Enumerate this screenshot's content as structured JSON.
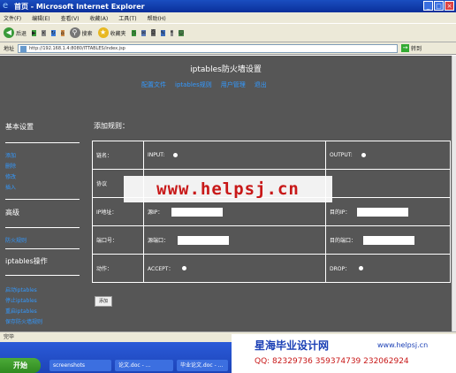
{
  "window": {
    "title": "首页 - Microsoft Internet Explorer",
    "min": "_",
    "max": "□",
    "close": "×"
  },
  "menu": [
    "文件(F)",
    "编辑(E)",
    "查看(V)",
    "收藏(A)",
    "工具(T)",
    "帮助(H)"
  ],
  "toolbar": {
    "back": "后退",
    "search": "搜索",
    "favorites": "收藏夹"
  },
  "address": {
    "url": "http://192.168.1.4:8080/ITTABLES/index.jsp",
    "go": "转到"
  },
  "page": {
    "title": "iptables防火墙设置",
    "nav": [
      "配置文件",
      "iptables规则",
      "用户管理",
      "退出"
    ],
    "sidebar": {
      "basic_heading": "基本设置",
      "basic_links": [
        "添加",
        "删除",
        "修改",
        "插入"
      ],
      "advanced_heading": "高级",
      "advanced_links": [
        "防火规则"
      ],
      "ops_heading": "iptables操作",
      "ops_links": [
        "启动iptables",
        "停止iptables",
        "重启iptables",
        "保存防火墙规则"
      ]
    },
    "form_title": "添加规则：",
    "rows": {
      "chain_label": "链名：",
      "input_label": "INPUT:",
      "output_label": "OUTPUT:",
      "protocol_label": "协议",
      "ip_label": "IP地址：",
      "src_ip_label": "源IP：",
      "dst_ip_label": "目的IP：",
      "port_label": "端口号：",
      "src_port_label": "源端口：",
      "dst_port_label": "目的端口：",
      "action_label": "动作：",
      "accept_label": "ACCEPT：",
      "drop_label": "DROP："
    },
    "add_button": "添加"
  },
  "watermark": "www.helpsj.cn",
  "status": "完毕",
  "taskbar": {
    "start": "开始",
    "tasks": [
      "screenshots",
      "论文.doc - ...",
      "毕业论文.doc - ..."
    ]
  },
  "banner": {
    "title": "星海毕业设计网",
    "url": "www.helpsj.cn",
    "qq": "QQ: 82329736  359374739  232062924"
  }
}
